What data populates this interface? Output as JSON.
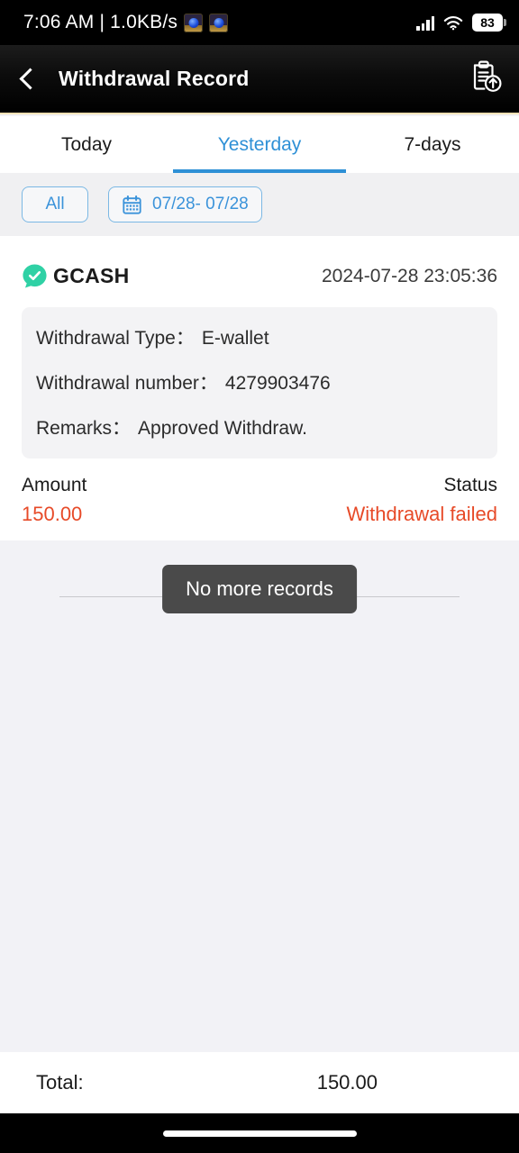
{
  "status_bar": {
    "time": "7:06 AM | 1.0KB/s",
    "battery_level": "83",
    "icons": [
      "app-icon",
      "app-icon",
      "signal-icon",
      "wifi-icon",
      "battery-icon"
    ]
  },
  "app_bar": {
    "title": "Withdrawal Record",
    "back_icon": "chevron-left-icon",
    "action_icon": "clipboard-upload-icon",
    "accent_line_color": "#f4e2b6"
  },
  "tabs": {
    "items": [
      {
        "label": "Today",
        "active": false
      },
      {
        "label": "Yesterday",
        "active": true
      },
      {
        "label": "7-days",
        "active": false
      }
    ],
    "active_color": "#2e90d6"
  },
  "filters": {
    "all_label": "All",
    "date_range_label": "07/28- 07/28",
    "calendar_icon": "calendar-icon",
    "accent_color": "#3b93da"
  },
  "record": {
    "brand": "GCASH",
    "brand_icon": "gcash-check-bubble-icon",
    "brand_icon_color": "#2fd1a5",
    "timestamp": "2024-07-28 23:05:36",
    "details": [
      {
        "label": "Withdrawal Type：",
        "value": "E-wallet"
      },
      {
        "label": "Withdrawal number：",
        "value": "4279903476"
      },
      {
        "label": "Remarks：",
        "value": "Approved Withdraw."
      }
    ],
    "amount_label": "Amount",
    "amount_value": "150.00",
    "status_label": "Status",
    "status_value": "Withdrawal failed",
    "status_color": "#e74a28"
  },
  "list_end": {
    "divider_text": "No more records"
  },
  "toast": {
    "message": "No more records"
  },
  "footer": {
    "total_label": "Total:",
    "total_value": "150.00"
  }
}
